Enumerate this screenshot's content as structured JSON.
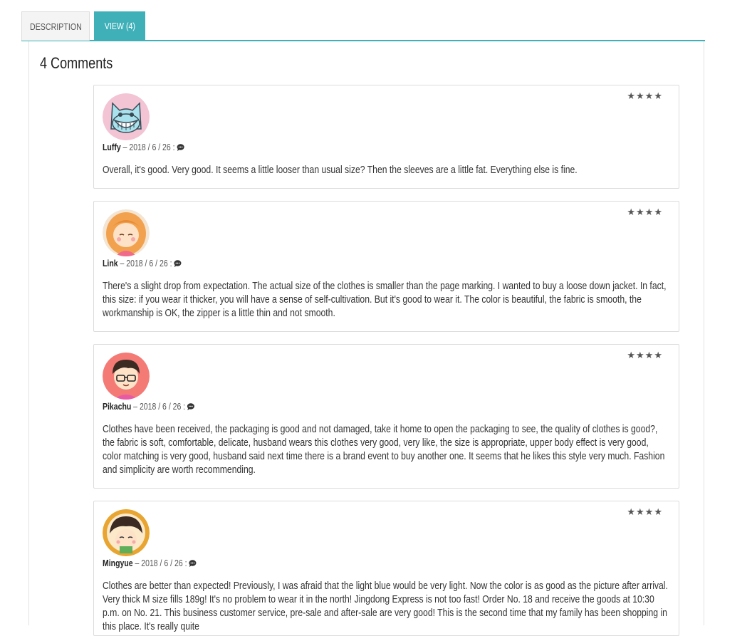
{
  "tabs": {
    "description": "DESCRIPTION",
    "view": "VIEW (4)"
  },
  "heading": "4 Comments",
  "reviews": [
    {
      "author": "Luffy",
      "date": "2018 / 6 / 26 :",
      "stars": "★★★★",
      "text": "Overall, it's good. Very good. It seems a little looser than usual size? Then the sleeves are a little fat. Everything else is fine."
    },
    {
      "author": "Link",
      "date": "2018 / 6 / 26 :",
      "stars": "★★★★",
      "text": "There's a slight drop from expectation. The actual size of the clothes is smaller than the page marking. I wanted to buy a loose down jacket. In fact, this size: if you wear it thicker, you will have a sense of self-cultivation. But it's good to wear it. The color is beautiful, the fabric is smooth, the workmanship is OK, the zipper is a little thin and not smooth."
    },
    {
      "author": "Pikachu",
      "date": "2018 / 6 / 26 :",
      "stars": "★★★★",
      "text": "Clothes have been received, the packaging is good and not damaged, take it home to open the packaging to see, the quality of clothes is good?, the fabric is soft, comfortable, delicate, husband wears this clothes very good, very like, the size is appropriate, upper body effect is very good, color matching is very good, husband said next time there is a brand event to buy another one. It seems that he likes this style very much. Fashion and simplicity are worth recommending."
    },
    {
      "author": "Mingyue",
      "date": "2018 / 6 / 26 :",
      "stars": "★★★★",
      "text": "Clothes are better than expected! Previously, I was afraid that the light blue would be very light. Now the color is as good as the picture after arrival. Very thick M size fills 189g! It's no problem to wear it in the north! Jingdong Express is not too fast! Order No. 18 and receive the goods at 10:30 p.m. on No. 21. This business customer service, pre-sale and after-sale are very good! This is the second time that my family has been shopping in this place. It's really quite"
    }
  ],
  "colors": {
    "accent": "#3fb0b8",
    "star": "#555555"
  }
}
